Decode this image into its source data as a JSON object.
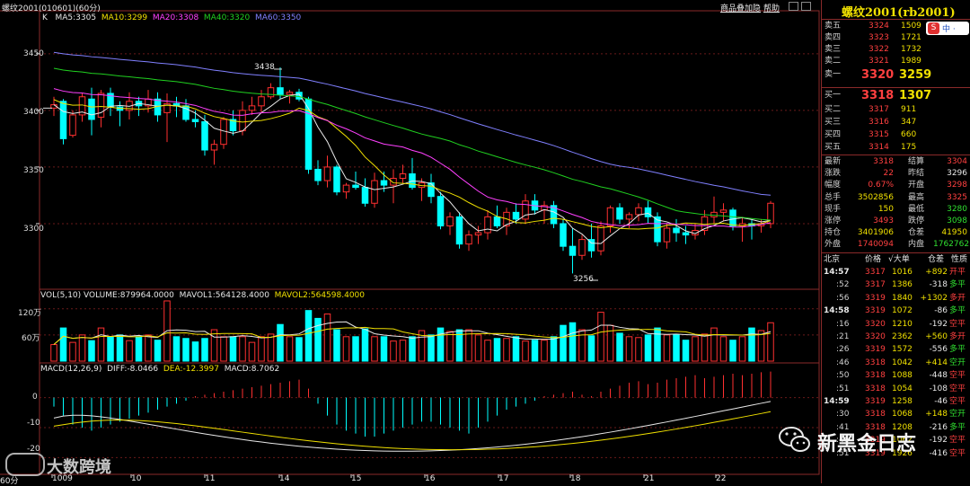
{
  "header": {
    "title": "螺纹2001(010601)(60分)",
    "links": [
      "商品叠加",
      "隐",
      "帮助"
    ]
  },
  "ma_legend": {
    "k": "K",
    "ma5": "MA5:3305",
    "ma10": "MA10:3299",
    "ma20": "MA20:3308",
    "ma40": "MA40:3320",
    "ma60": "MA60:3350"
  },
  "vol_legend": {
    "vol": "VOL(5,10)  VOLUME:879964.0000",
    "mavol1": "MAVOL1:564128.4000",
    "mavol2": "MAVOL2:564598.4000"
  },
  "macd_legend": {
    "name": "MACD(12,26,9)",
    "diff": "DIFF:-8.0466",
    "dea": "DEA:-12.3997",
    "macd": "MACD:8.7062"
  },
  "annotations": {
    "high": "3438",
    "low": "3256"
  },
  "price_axis_labels": [
    "3450",
    "3400",
    "3350",
    "3300"
  ],
  "vol_axis_labels": [
    "120万",
    "60万"
  ],
  "macd_axis_labels": [
    "0",
    "-10",
    "-20"
  ],
  "date_labels": [
    "1009",
    "10",
    "11",
    "14",
    "15",
    "16",
    "17",
    "18",
    "21",
    "22"
  ],
  "period_label": "60分",
  "watermark_left": "大数跨境",
  "watermark_right": "新黑金日志",
  "colors": {
    "up": "#ff3030",
    "down": "#00ffff",
    "ma5": "#e8e8e8",
    "ma10": "#f0e000",
    "ma20": "#ff40ff",
    "ma40": "#20d020",
    "ma60": "#8080ff",
    "grid": "#8a2a2a"
  },
  "chart_data": [
    {
      "type": "candlestick",
      "title": "螺纹2001(010601)(60分)",
      "x": [
        "1009",
        "10",
        "11",
        "14",
        "15",
        "16",
        "17",
        "18",
        "21",
        "22"
      ],
      "ylim": [
        3250,
        3480
      ],
      "series": [
        {
          "name": "K",
          "ohlc": [
            [
              3402,
              3412,
              3395,
              3405
            ],
            [
              3408,
              3410,
              3370,
              3375
            ],
            [
              3378,
              3400,
              3376,
              3396
            ],
            [
              3396,
              3415,
              3390,
              3412
            ],
            [
              3410,
              3420,
              3378,
              3392
            ],
            [
              3394,
              3418,
              3385,
              3415
            ],
            [
              3415,
              3420,
              3395,
              3403
            ],
            [
              3403,
              3408,
              3386,
              3400
            ],
            [
              3400,
              3416,
              3392,
              3408
            ],
            [
              3408,
              3412,
              3395,
              3404
            ],
            [
              3404,
              3418,
              3398,
              3410
            ],
            [
              3410,
              3416,
              3390,
              3396
            ],
            [
              3398,
              3415,
              3372,
              3406
            ],
            [
              3406,
              3412,
              3394,
              3404
            ],
            [
              3404,
              3410,
              3390,
              3392
            ],
            [
              3392,
              3400,
              3385,
              3390
            ],
            [
              3390,
              3396,
              3360,
              3365
            ],
            [
              3365,
              3374,
              3352,
              3370
            ],
            [
              3370,
              3394,
              3366,
              3392
            ],
            [
              3392,
              3400,
              3378,
              3382
            ],
            [
              3382,
              3408,
              3378,
              3400
            ],
            [
              3400,
              3412,
              3396,
              3404
            ],
            [
              3404,
              3418,
              3398,
              3412
            ],
            [
              3412,
              3424,
              3410,
              3420
            ],
            [
              3420,
              3438,
              3410,
              3414
            ],
            [
              3414,
              3418,
              3406,
              3416
            ],
            [
              3416,
              3419,
              3408,
              3410
            ],
            [
              3410,
              3412,
              3344,
              3348
            ],
            [
              3348,
              3356,
              3334,
              3338
            ],
            [
              3338,
              3360,
              3332,
              3350
            ],
            [
              3350,
              3352,
              3325,
              3328
            ],
            [
              3328,
              3336,
              3322,
              3334
            ],
            [
              3334,
              3346,
              3330,
              3332
            ],
            [
              3332,
              3340,
              3315,
              3318
            ],
            [
              3318,
              3345,
              3314,
              3338
            ],
            [
              3338,
              3346,
              3328,
              3334
            ],
            [
              3334,
              3348,
              3318,
              3340
            ],
            [
              3340,
              3352,
              3336,
              3344
            ],
            [
              3344,
              3358,
              3330,
              3332
            ],
            [
              3332,
              3340,
              3320,
              3336
            ],
            [
              3336,
              3344,
              3318,
              3324
            ],
            [
              3324,
              3328,
              3295,
              3298
            ],
            [
              3298,
              3310,
              3290,
              3306
            ],
            [
              3306,
              3310,
              3278,
              3282
            ],
            [
              3282,
              3294,
              3276,
              3290
            ],
            [
              3290,
              3298,
              3282,
              3292
            ],
            [
              3292,
              3312,
              3286,
              3306
            ],
            [
              3306,
              3316,
              3296,
              3298
            ],
            [
              3298,
              3314,
              3290,
              3310
            ],
            [
              3310,
              3318,
              3300,
              3304
            ],
            [
              3304,
              3326,
              3300,
              3320
            ],
            [
              3320,
              3326,
              3308,
              3312
            ],
            [
              3312,
              3320,
              3300,
              3316
            ],
            [
              3316,
              3320,
              3296,
              3300
            ],
            [
              3300,
              3304,
              3276,
              3280
            ],
            [
              3280,
              3296,
              3256,
              3272
            ],
            [
              3272,
              3290,
              3268,
              3286
            ],
            [
              3286,
              3300,
              3270,
              3276
            ],
            [
              3276,
              3302,
              3272,
              3298
            ],
            [
              3298,
              3316,
              3292,
              3314
            ],
            [
              3314,
              3318,
              3300,
              3304
            ],
            [
              3304,
              3310,
              3296,
              3308
            ],
            [
              3308,
              3318,
              3302,
              3314
            ],
            [
              3314,
              3320,
              3300,
              3306
            ],
            [
              3306,
              3310,
              3280,
              3284
            ],
            [
              3284,
              3300,
              3278,
              3296
            ],
            [
              3296,
              3304,
              3284,
              3292
            ],
            [
              3292,
              3298,
              3282,
              3290
            ],
            [
              3290,
              3300,
              3286,
              3294
            ],
            [
              3294,
              3312,
              3290,
              3306
            ],
            [
              3306,
              3324,
              3300,
              3310
            ],
            [
              3310,
              3318,
              3302,
              3312
            ],
            [
              3312,
              3314,
              3294,
              3298
            ],
            [
              3298,
              3306,
              3284,
              3300
            ],
            [
              3300,
              3304,
              3286,
              3298
            ],
            [
              3298,
              3304,
              3292,
              3300
            ],
            [
              3300,
              3320,
              3296,
              3318
            ]
          ]
        },
        {
          "name": "MA5"
        },
        {
          "name": "MA10"
        },
        {
          "name": "MA20"
        },
        {
          "name": "MA40"
        },
        {
          "name": "MA60"
        }
      ]
    },
    {
      "type": "bar",
      "title": "VOL(5,10)",
      "ylim": [
        0,
        1400000
      ],
      "values": [
        380000,
        760000,
        430000,
        600000,
        470000,
        760000,
        560000,
        600000,
        470000,
        560000,
        600000,
        480000,
        1380000,
        560000,
        520000,
        440000,
        520000,
        720000,
        560000,
        560000,
        560000,
        430000,
        560000,
        620000,
        840000,
        560000,
        540000,
        1160000,
        980000,
        1080000,
        720000,
        560000,
        560000,
        740000,
        560000,
        560000,
        460000,
        480000,
        560000,
        700000,
        600000,
        760000,
        680000,
        720000,
        720000,
        600000,
        480000,
        520000,
        520000,
        560000,
        460000,
        480000,
        480000,
        560000,
        820000,
        880000,
        720000,
        580000,
        1120000,
        820000,
        640000,
        560000,
        540000,
        600000,
        760000,
        600000,
        600000,
        480000,
        560000,
        620000,
        760000,
        560000,
        480000,
        560000,
        760000,
        700000,
        880000
      ]
    },
    {
      "type": "bar",
      "title": "MACD(12,26,9)",
      "ylim": [
        -25,
        8
      ],
      "values": [
        -3,
        -6,
        -9,
        -10,
        -11,
        -10,
        -9,
        -8,
        -7,
        -6,
        -5,
        -4,
        -3,
        -2,
        -1,
        0.5,
        1,
        1.5,
        2,
        2.5,
        3,
        3.5,
        4,
        4.5,
        5,
        5.5,
        6,
        3,
        -2,
        -6,
        -9,
        -11,
        -12,
        -13,
        -13,
        -12,
        -11,
        -10,
        -9,
        -8,
        -8,
        -9,
        -10,
        -11,
        -12,
        -10,
        -8,
        -6,
        -4,
        -3,
        -2,
        -1,
        0.5,
        1,
        1.5,
        2,
        1,
        0.5,
        2,
        3,
        4,
        5,
        5.5,
        4.5,
        5,
        6,
        6.5,
        7,
        7.5,
        6.5,
        7,
        7.5,
        8,
        7.5,
        8,
        8.5,
        8.7
      ]
    }
  ],
  "quote_panel": {
    "title": "螺纹2001(rb2001)",
    "asks": [
      {
        "label": "卖五",
        "price": "3324",
        "vol": "1509"
      },
      {
        "label": "卖四",
        "price": "3323",
        "vol": "1721"
      },
      {
        "label": "卖三",
        "price": "3322",
        "vol": "1732"
      },
      {
        "label": "卖二",
        "price": "3321",
        "vol": "1989"
      },
      {
        "label": "卖一",
        "price": "3320",
        "vol": "3259"
      }
    ],
    "bids": [
      {
        "label": "买一",
        "price": "3318",
        "vol": "1307"
      },
      {
        "label": "买二",
        "price": "3317",
        "vol": "911"
      },
      {
        "label": "买三",
        "price": "3316",
        "vol": "347"
      },
      {
        "label": "买四",
        "price": "3315",
        "vol": "660"
      },
      {
        "label": "买五",
        "price": "3314",
        "vol": "175"
      }
    ],
    "stats": [
      {
        "l1": "最新",
        "v1": "3318",
        "c1": "red",
        "l2": "结算",
        "v2": "3304",
        "c2": "red"
      },
      {
        "l1": "涨跌",
        "v1": "22",
        "c1": "red",
        "l2": "昨结",
        "v2": "3296",
        "c2": "white"
      },
      {
        "l1": "幅度",
        "v1": "0.67%",
        "c1": "red",
        "l2": "开盘",
        "v2": "3298",
        "c2": "red"
      },
      {
        "l1": "总手",
        "v1": "3502856",
        "c1": "yellow",
        "l2": "最高",
        "v2": "3325",
        "c2": "red"
      },
      {
        "l1": "现手",
        "v1": "150",
        "c1": "yellow",
        "l2": "最低",
        "v2": "3280",
        "c2": "green"
      },
      {
        "l1": "涨停",
        "v1": "3493",
        "c1": "red",
        "l2": "跌停",
        "v2": "3098",
        "c2": "green"
      },
      {
        "l1": "持仓",
        "v1": "3401906",
        "c1": "yellow",
        "l2": "仓差",
        "v2": "41950",
        "c2": "yellow"
      },
      {
        "l1": "外盘",
        "v1": "1740094",
        "c1": "red",
        "l2": "内盘",
        "v2": "1762762",
        "c2": "green"
      }
    ],
    "tick_header": {
      "place": "北京",
      "price": "价格",
      "vol": "√大单",
      "diff": "仓差",
      "nature": "性质"
    },
    "ticks": [
      {
        "t": "14:57",
        "p": "3317",
        "pc": "red",
        "v": "1016",
        "d": "+892",
        "n": "开平",
        "nc": "red"
      },
      {
        "t": ":52",
        "p": "3317",
        "pc": "red",
        "v": "1386",
        "d": "-318",
        "n": "多平",
        "nc": "green"
      },
      {
        "t": ":56",
        "p": "3319",
        "pc": "red",
        "v": "1840",
        "d": "+1302",
        "n": "多开",
        "nc": "red"
      },
      {
        "t": "14:58",
        "p": "3319",
        "pc": "red",
        "v": "1072",
        "d": "-86",
        "n": "多平",
        "nc": "green"
      },
      {
        "t": ":16",
        "p": "3320",
        "pc": "red",
        "v": "1210",
        "d": "-192",
        "n": "空平",
        "nc": "red"
      },
      {
        "t": ":21",
        "p": "3320",
        "pc": "red",
        "v": "2362",
        "d": "+560",
        "n": "多开",
        "nc": "red"
      },
      {
        "t": ":26",
        "p": "3319",
        "pc": "red",
        "v": "1572",
        "d": "-556",
        "n": "多平",
        "nc": "green"
      },
      {
        "t": ":46",
        "p": "3318",
        "pc": "red",
        "v": "1042",
        "d": "+414",
        "n": "空开",
        "nc": "green"
      },
      {
        "t": ":50",
        "p": "3318",
        "pc": "red",
        "v": "1088",
        "d": "-448",
        "n": "空平",
        "nc": "red"
      },
      {
        "t": ":51",
        "p": "3318",
        "pc": "red",
        "v": "1054",
        "d": "-108",
        "n": "空平",
        "nc": "red"
      },
      {
        "t": "14:59",
        "p": "3319",
        "pc": "red",
        "v": "1258",
        "d": "-46",
        "n": "空平",
        "nc": "red"
      },
      {
        "t": ":30",
        "p": "3318",
        "pc": "red",
        "v": "1068",
        "d": "+148",
        "n": "空开",
        "nc": "green"
      },
      {
        "t": ":41",
        "p": "3318",
        "pc": "red",
        "v": "1208",
        "d": "-216",
        "n": "多平",
        "nc": "green"
      },
      {
        "t": ":46",
        "p": "3319",
        "pc": "red",
        "v": "1062",
        "d": "-192",
        "n": "空平",
        "nc": "red"
      },
      {
        "t": ":51",
        "p": "3319",
        "pc": "red",
        "v": "1926",
        "d": "-416",
        "n": "空平",
        "nc": "red"
      }
    ]
  }
}
